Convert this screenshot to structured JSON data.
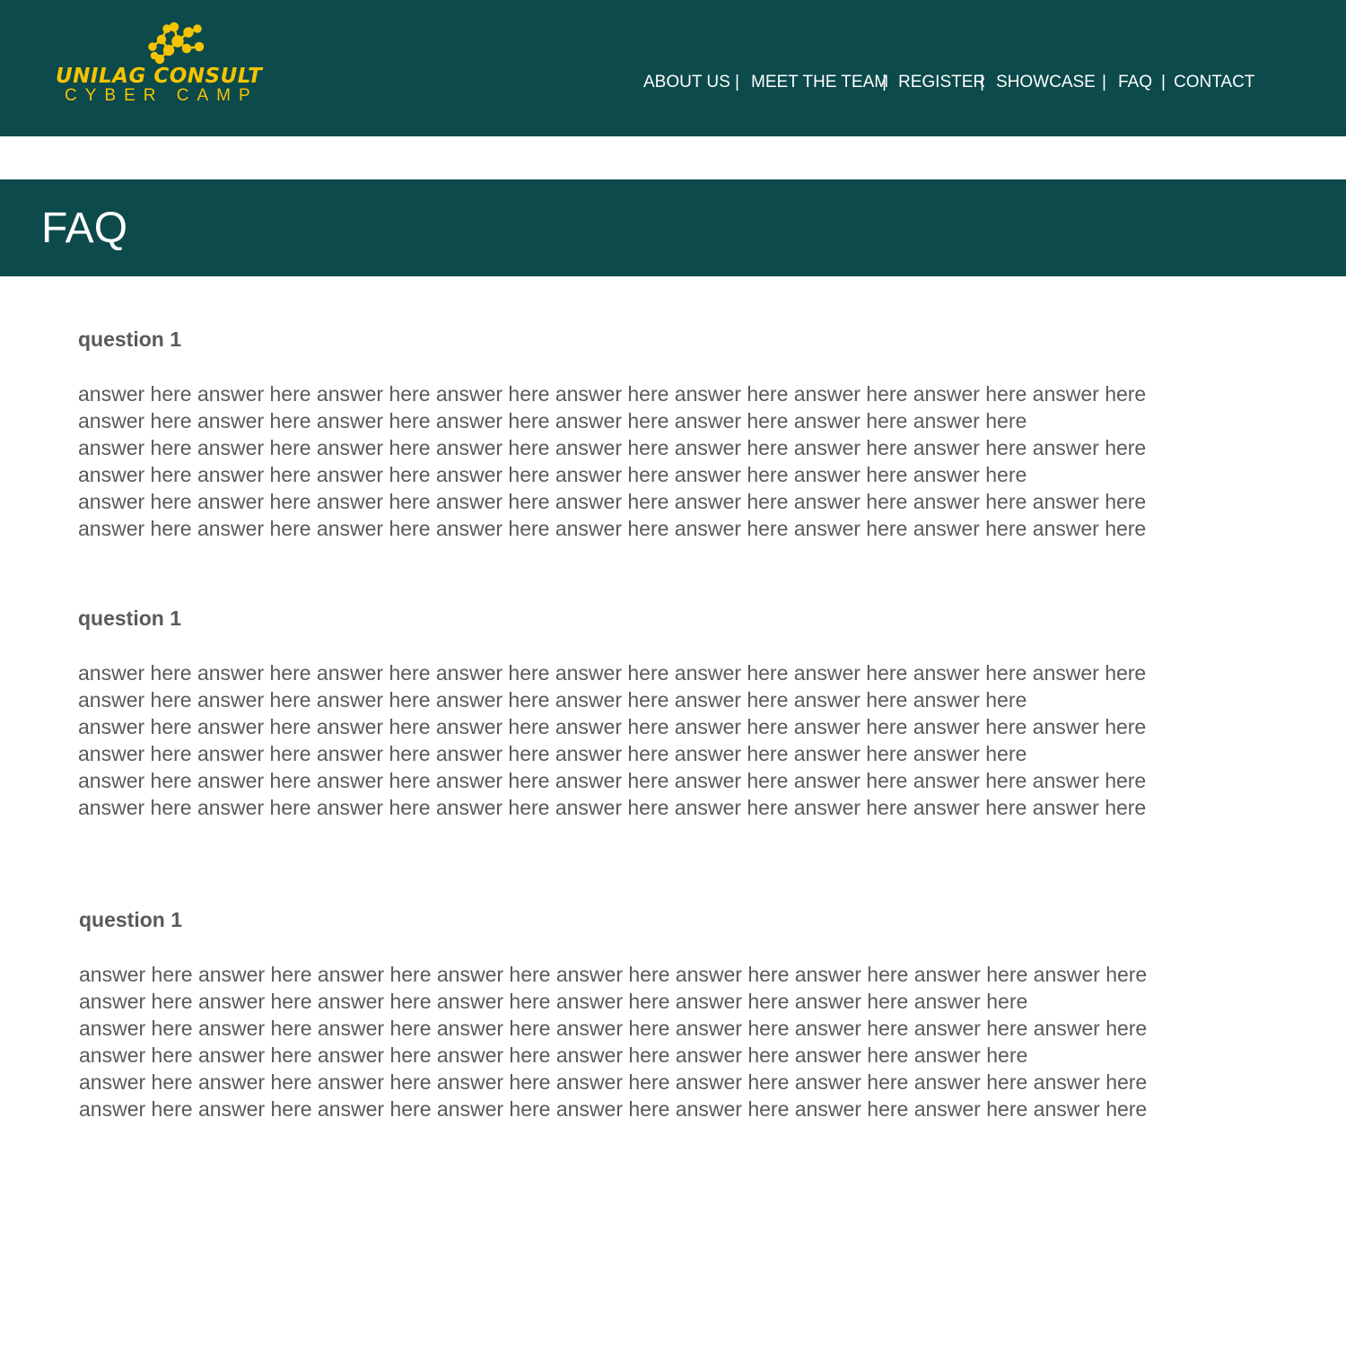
{
  "header": {
    "logo": {
      "line1": "UNILAG CONSULT",
      "line2": "CYBER CAMP",
      "accent": "#f5c400"
    },
    "background": "#0c4a4b",
    "nav": [
      {
        "label": "ABOUT US"
      },
      {
        "label": "MEET THE TEAM"
      },
      {
        "label": "REGISTER"
      },
      {
        "label": "SHOWCASE"
      },
      {
        "label": "FAQ"
      },
      {
        "label": "CONTACT"
      }
    ],
    "nav_separator": "|"
  },
  "banner": {
    "title": "FAQ"
  },
  "faq": [
    {
      "question": "question 1",
      "answer_lines": [
        "answer here answer here answer here answer here answer here answer here answer here answer here answer here",
        "answer here answer here answer here answer here answer here answer here answer here answer here",
        "answer here answer here answer here answer here answer here answer here answer here answer here answer here",
        "answer here answer here answer here answer here answer here answer here answer here answer here",
        "answer here answer here answer here answer here answer here answer here answer here answer here answer here",
        "answer here answer here answer here answer here answer here answer here answer here answer here answer here"
      ]
    },
    {
      "question": "question 1",
      "answer_lines": [
        "answer here answer here answer here answer here answer here answer here answer here answer here answer here",
        "answer here answer here answer here answer here answer here answer here answer here answer here",
        "answer here answer here answer here answer here answer here answer here answer here answer here answer here",
        "answer here answer here answer here answer here answer here answer here answer here answer here",
        "answer here answer here answer here answer here answer here answer here answer here answer here answer here",
        "answer here answer here answer here answer here answer here answer here answer here answer here answer here"
      ]
    },
    {
      "question": "question 1",
      "answer_lines": [
        "answer here answer here answer here answer here answer here answer here answer here answer here answer here",
        "answer here answer here answer here answer here answer here answer here answer here answer here",
        "answer here answer here answer here answer here answer here answer here answer here answer here answer here",
        "answer here answer here answer here answer here answer here answer here answer here answer here",
        "answer here answer here answer here answer here answer here answer here answer here answer here answer here",
        "answer here answer here answer here answer here answer here answer here answer here answer here answer here"
      ]
    }
  ]
}
